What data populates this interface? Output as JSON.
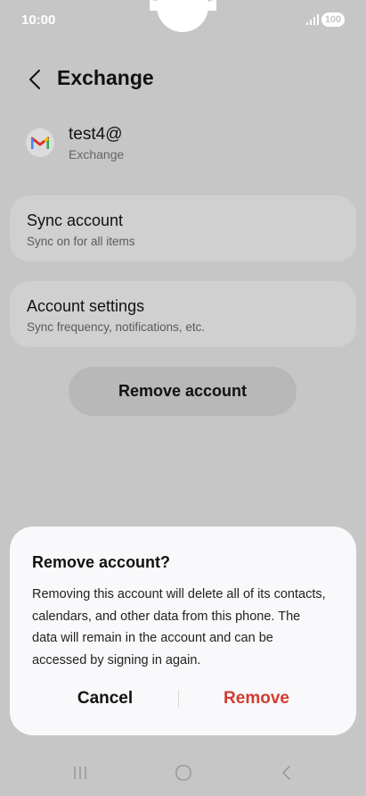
{
  "status_bar": {
    "time": "10:00",
    "battery": "100"
  },
  "header": {
    "title": "Exchange",
    "back_icon": "chevron-left-icon"
  },
  "account": {
    "name": "test4@",
    "type": "Exchange",
    "icon": "gmail-icon"
  },
  "items": [
    {
      "title": "Sync account",
      "subtitle": "Sync on for all items"
    },
    {
      "title": "Account settings",
      "subtitle": "Sync frequency, notifications, etc."
    }
  ],
  "remove_account_label": "Remove account",
  "dialog": {
    "title": "Remove account?",
    "message": "Removing this account will delete all of its contacts, calendars, and other data from this phone. The data will remain in the account and can be accessed by signing in again.",
    "cancel_label": "Cancel",
    "confirm_label": "Remove",
    "confirm_color": "#d23c2f"
  },
  "nav_bar": {
    "icons": [
      "recent-apps-icon",
      "home-icon",
      "back-icon"
    ]
  },
  "colors": {
    "scrim_background": "#c6c6c6",
    "dialog_background": "#f9f9fb"
  }
}
